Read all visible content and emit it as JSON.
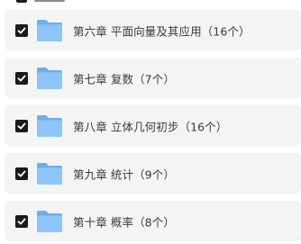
{
  "items": [
    {
      "label": "第六章 平面向量及其应用（16个）",
      "checked": true,
      "icon": "folder-icon"
    },
    {
      "label": "第七章 复数（7个）",
      "checked": true,
      "icon": "folder-icon"
    },
    {
      "label": "第八章 立体几何初步（16个）",
      "checked": true,
      "icon": "folder-icon"
    },
    {
      "label": "第九章 统计（9个）",
      "checked": true,
      "icon": "folder-icon"
    },
    {
      "label": "第十章 概率（8个）",
      "checked": true,
      "icon": "folder-icon"
    }
  ],
  "colors": {
    "row_bg": "#f4f4f4",
    "checkbox": "#1b1b1b",
    "folder_back": "#6aaef3",
    "folder_front": "#8cc5fb",
    "text": "#3a3a3a"
  }
}
